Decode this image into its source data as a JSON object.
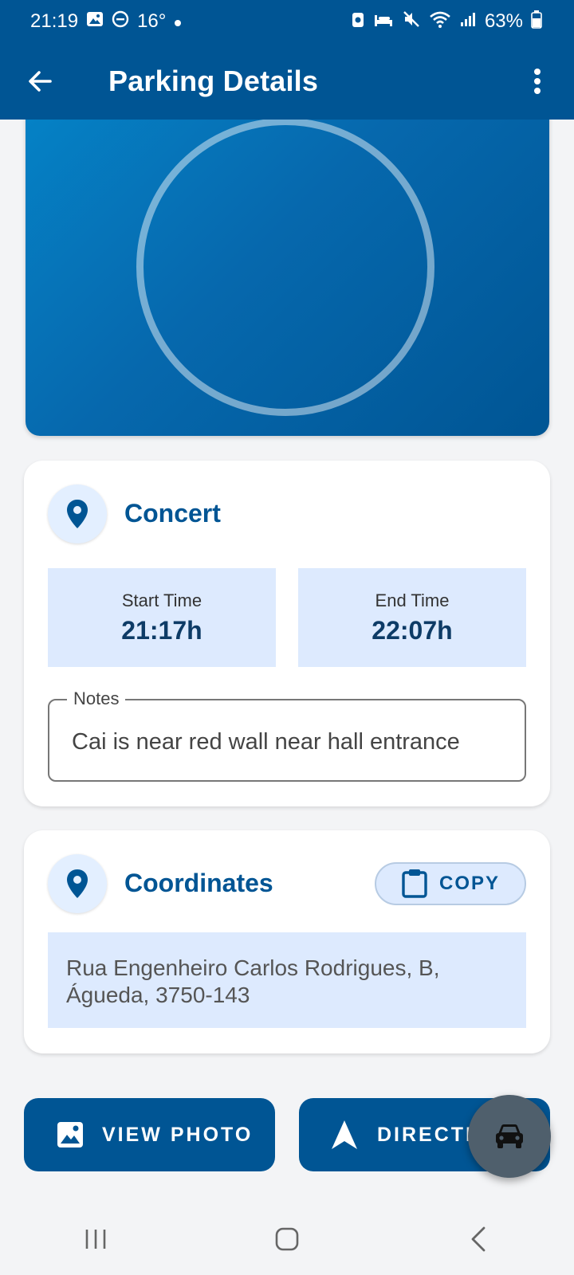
{
  "status_bar": {
    "time": "21:19",
    "temperature": "16°",
    "battery": "63%",
    "icons": [
      "gallery-icon",
      "dnd-icon",
      "dot-icon",
      "data-saver-icon",
      "sleep-icon",
      "mute-icon",
      "wifi-icon",
      "signal-icon",
      "battery-icon"
    ]
  },
  "app_bar": {
    "title": "Parking Details",
    "back_icon": "arrow-left-icon",
    "more_icon": "more-vert-icon"
  },
  "parking": {
    "name": "Concert",
    "start_label": "Start Time",
    "start_value": "21:17h",
    "end_label": "End Time",
    "end_value": "22:07h",
    "notes_label": "Notes",
    "notes_value": "Cai is near red wall near hall entrance"
  },
  "coordinates": {
    "title": "Coordinates",
    "copy_label": "COPY",
    "address_line1": "Rua Engenheiro Carlos Rodrigues, B,",
    "address_line2": "Águeda, 3750-143"
  },
  "actions": {
    "view_photo_label": "VIEW PHOTO",
    "directions_label": "DIRECTIONS"
  },
  "colors": {
    "primary": "#005594",
    "accent_light": "#ddeafe",
    "fab": "#4f5f6c"
  }
}
